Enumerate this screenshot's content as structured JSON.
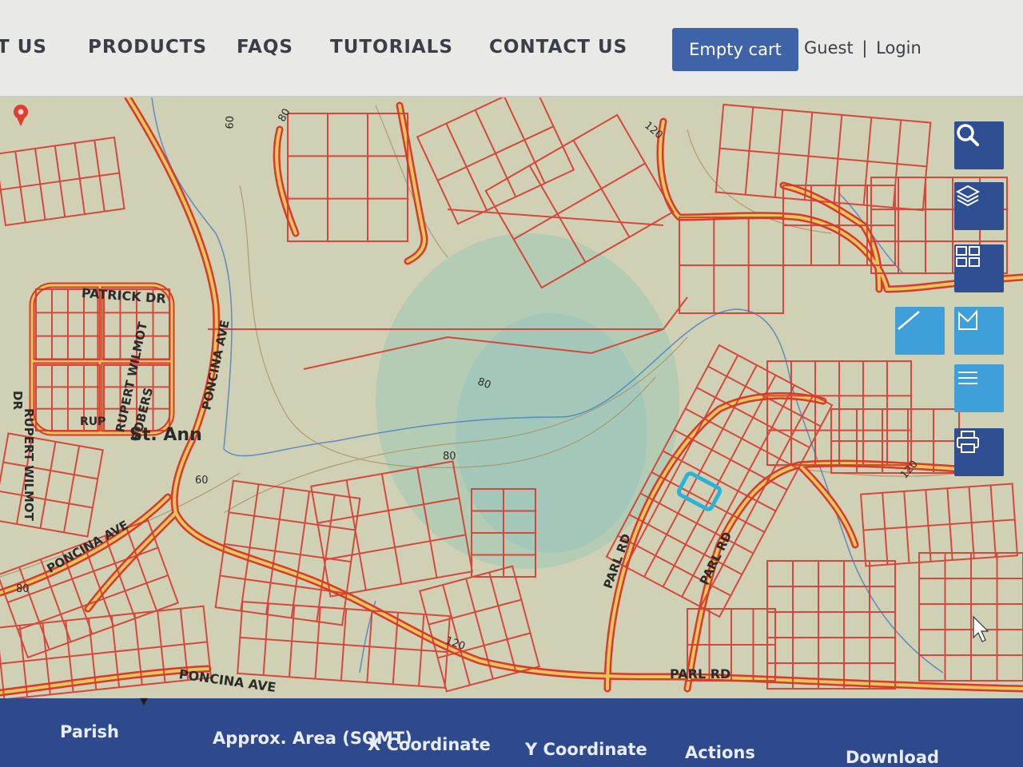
{
  "nav": {
    "items": [
      "T US",
      "PRODUCTS",
      "FAQS",
      "TUTORIALS",
      "CONTACT US"
    ],
    "cart_label": "Empty cart",
    "guest_label": "Guest",
    "separator": "|",
    "login_label": "Login"
  },
  "map": {
    "streets": {
      "patrick": "PATRICK DR",
      "rupert_1": "RUPERT WILMOT",
      "rupert_2": "DR",
      "wilmot_1": "RUPERT WILMOT",
      "wilmot_2": "SOBERS",
      "rup": "RUP",
      "poncina_ave_1": "PONCINA AVE",
      "poncina_ave_2": "PONCINA AVE",
      "poncina_ave_3": "PONCINA AVE",
      "parl_rd_1": "PARL RD",
      "parl_rd_2": "PARL RD",
      "parl_rd_3": "PARL RD"
    },
    "place": "St. Ann",
    "contours": [
      "60",
      "80",
      "120",
      "80",
      "80",
      "60",
      "120",
      "80",
      "120"
    ]
  },
  "tools": [
    "search-icon",
    "layers-icon",
    "grid-icon",
    "measure-line-icon",
    "measure-area-icon",
    "list-icon",
    "print-icon"
  ],
  "table": {
    "columns": [
      "Parish",
      "Approx. Area (SQMT)",
      "X Coordinate",
      "Y Coordinate",
      "Actions",
      "Download"
    ],
    "sort_indicator": "▼"
  },
  "colors": {
    "header_bg": "#e9e9e7",
    "nav_text": "#3a3f47",
    "button_blue": "#3f63a8",
    "tool_blue": "#2f4f92",
    "footer_blue": "#2e4a8c",
    "map_bg": "#cfd0b4",
    "parcel_line": "#d9392f",
    "road_fill": "#e4c65a",
    "highlight": "#2ab3d6"
  }
}
